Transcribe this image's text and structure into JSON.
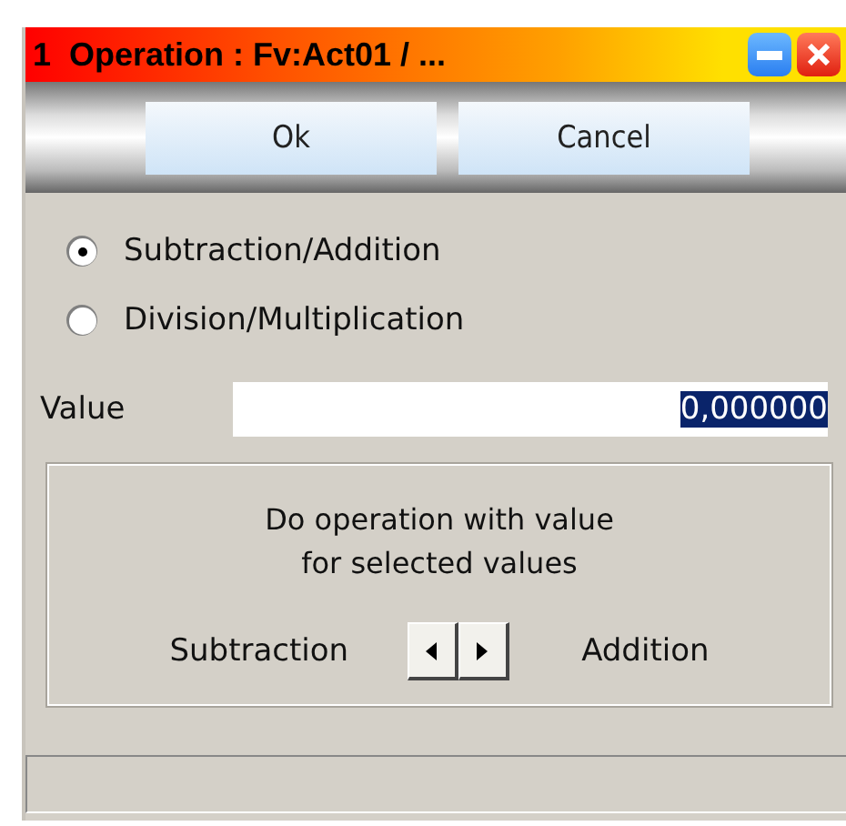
{
  "window": {
    "title": "1  Operation : Fv:Act01 / ..."
  },
  "buttons": [
    "Ok",
    "Cancel"
  ],
  "options": [
    {
      "label": "Subtraction/Addition",
      "selected": true
    },
    {
      "label": "Division/Multiplication",
      "selected": false
    }
  ],
  "value_field": {
    "label": "Value",
    "value": "0,000000",
    "selected": true
  },
  "operation_group": {
    "text": "Do operation with value\nfor selected values",
    "left_label": "Subtraction",
    "right_label": "Addition"
  }
}
